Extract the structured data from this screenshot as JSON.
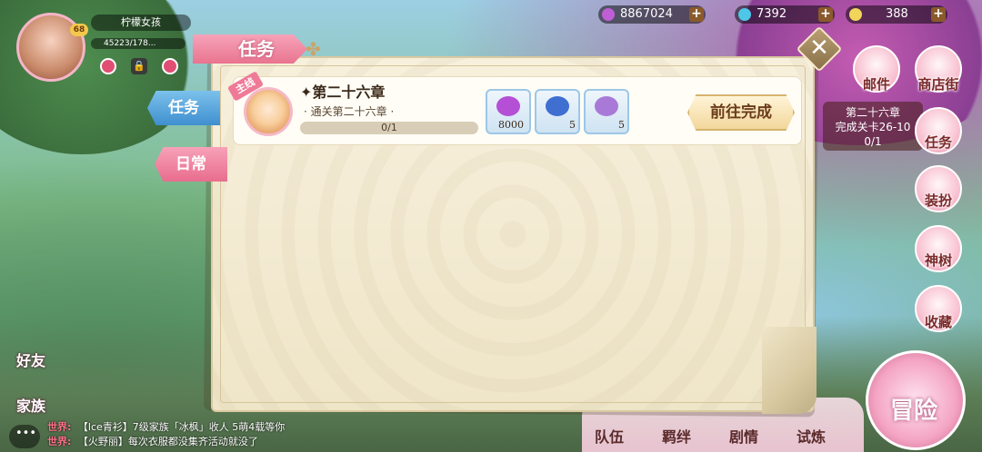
{
  "player": {
    "name": "柠檬女孩",
    "level": "68",
    "exp": "45223/178..."
  },
  "resources": [
    {
      "value": "8867024",
      "color": "#c05ed6"
    },
    {
      "value": "7392",
      "color": "#4ec6e8"
    },
    {
      "value": "388",
      "color": "#f1d55a"
    }
  ],
  "panel": {
    "title": "任务",
    "tabs": [
      "任务",
      "日常"
    ]
  },
  "quest": {
    "badge": "主线",
    "title": "第二十六章",
    "subtitle": "· 通关第二十六章 ·",
    "progress": "0/1",
    "progress_fraction": 0,
    "rewards": [
      {
        "icon": "gem-icon",
        "count": "8000",
        "color": "#b54fd6"
      },
      {
        "icon": "crystal-icon",
        "count": "5",
        "color": "#3f6fd1"
      },
      {
        "icon": "potion-icon",
        "count": "5",
        "color": "#a979d8"
      }
    ],
    "go_label": "前往完成"
  },
  "side_menu": {
    "items": [
      {
        "label": "邮件"
      },
      {
        "label": "商店街"
      },
      {
        "label": "任务"
      },
      {
        "label": "装扮"
      },
      {
        "label": "神树"
      },
      {
        "label": "收藏"
      }
    ],
    "mini_quest": {
      "title": "第二十六章",
      "sub": "完成关卡26-10",
      "progress": "0/1"
    }
  },
  "left_menu": {
    "friends": "好友",
    "family": "家族"
  },
  "chat": [
    {
      "tag": "世界:",
      "text": "【lce青衫】7级家族「冰枫」收人 5萌4载等你"
    },
    {
      "tag": "世界:",
      "text": "【火野丽】每次衣服都没集齐活动就没了"
    }
  ],
  "bottom_menu": [
    "队伍",
    "羁绊",
    "剧情",
    "试炼"
  ],
  "adventure_label": "冒险"
}
